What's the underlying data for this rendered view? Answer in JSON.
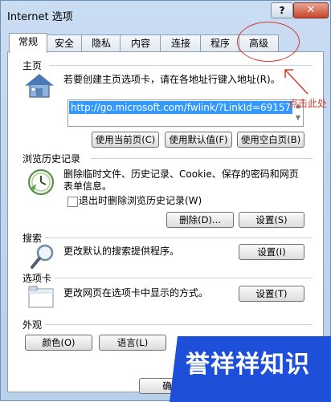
{
  "window": {
    "title": "Internet 选项",
    "help_label": "?",
    "close_label": "✕"
  },
  "tabs": [
    {
      "label": "常规"
    },
    {
      "label": "安全"
    },
    {
      "label": "隐私"
    },
    {
      "label": "内容"
    },
    {
      "label": "连接"
    },
    {
      "label": "程序"
    },
    {
      "label": "高级"
    }
  ],
  "homepage": {
    "section_title": "主页",
    "description": "若要创建主页选项卡，请在各地址行键入地址(R)。",
    "url": "http://go.microsoft.com/fwlink/?LinkId=69157",
    "btn_current": "使用当前页(C)",
    "btn_default": "使用默认值(F)",
    "btn_blank": "使用空白页(B)"
  },
  "history": {
    "section_title": "浏览历史记录",
    "description_line1": "删除临时文件、历史记录、Cookie、保存的密码和网页",
    "description_line2": "表单信息。",
    "checkbox_label": "退出时删除浏览历史记录(W)",
    "btn_delete": "删除(D)...",
    "btn_settings": "设置(S)"
  },
  "search": {
    "section_title": "搜索",
    "description": "更改默认的搜索提供程序。",
    "btn_settings": "设置(I)"
  },
  "tabs_section": {
    "section_title": "选项卡",
    "description": "更改网页在选项卡中显示的方式。",
    "btn_settings": "设置(T)"
  },
  "appearance": {
    "section_title": "外观",
    "btn_colors": "颜色(O)",
    "btn_languages": "语言(L)"
  },
  "footer": {
    "btn_ok_partial": "确"
  },
  "annotation": {
    "text": "点击此处",
    "color": "#d43a2e"
  },
  "watermark": {
    "text": "誉祥祥知识",
    "color": "#1d4fd8"
  }
}
